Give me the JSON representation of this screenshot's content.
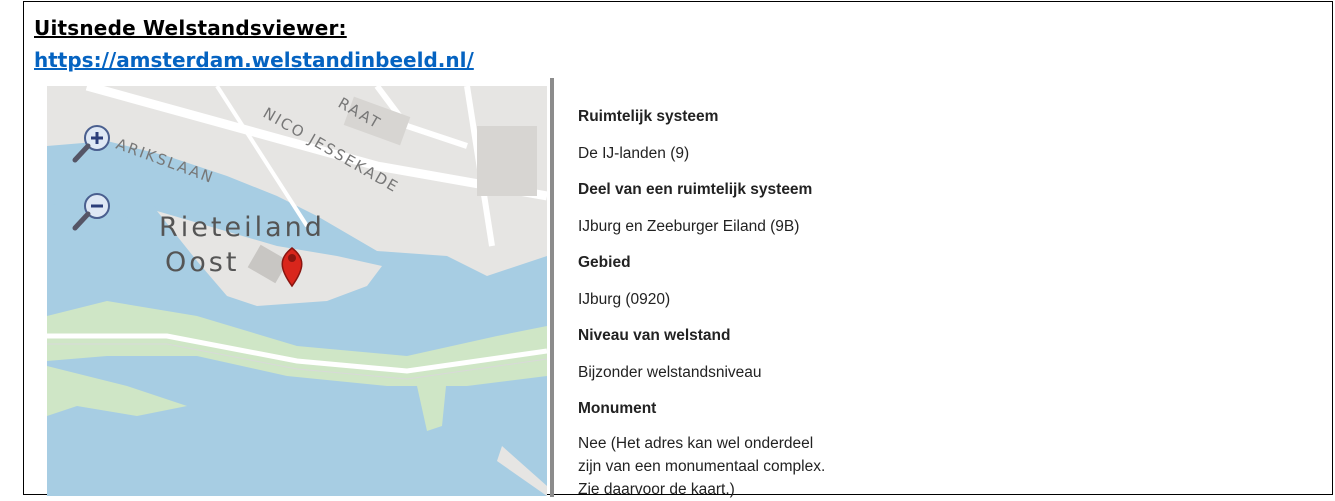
{
  "header": {
    "title": "Uitsnede Welstandsviewer:",
    "link": "https://amsterdam.welstandinbeeld.nl/"
  },
  "map": {
    "labels": [
      "Rieteiland",
      "Oost"
    ],
    "street_labels": [
      "NICO JESSEKADE",
      "PARIKSLAAN",
      "RAAT",
      "OOST"
    ],
    "controls": [
      "zoom-in",
      "zoom-out"
    ],
    "colors": {
      "water": "#a7cde3",
      "land": "#e6e5e3",
      "green": "#cfe6c6",
      "road": "#ffffff",
      "marker": "#d9261c"
    }
  },
  "info": {
    "fields": [
      {
        "label": "Ruimtelijk systeem",
        "value": "De IJ-landen (9)"
      },
      {
        "label": "Deel van een ruimtelijk systeem",
        "value": "IJburg en Zeeburger Eiland (9B)"
      },
      {
        "label": "Gebied",
        "value": "IJburg (0920)"
      },
      {
        "label": "Niveau van welstand",
        "value": "Bijzonder welstandsniveau"
      }
    ],
    "monument": {
      "label": "Monument",
      "lines": [
        "Nee (Het adres kan wel onderdeel",
        "zijn van een monumentaal complex.",
        "Zie daarvoor de kaart.)"
      ]
    }
  }
}
